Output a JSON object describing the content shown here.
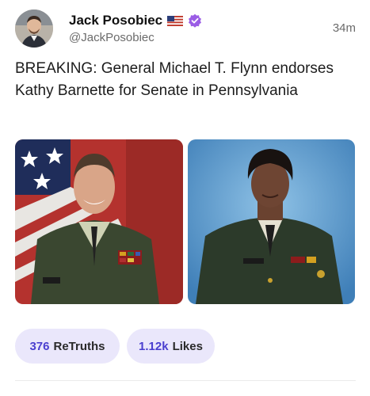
{
  "post": {
    "author_name": "Jack Posobiec",
    "author_handle": "@JackPosobiec",
    "timestamp": "34m",
    "text": "BREAKING: General Michael T. Flynn endorses Kathy Barnette for Senate in Pennsylvania",
    "flag_icon": "us-flag-icon",
    "verified_icon": "verified-badge-icon",
    "verified_color": "#9b5de5",
    "accent_color": "#4a3fcf",
    "pill_bg": "#eae7fb",
    "images": [
      {
        "icon": "photo-general-flynn"
      },
      {
        "icon": "photo-kathy-barnette"
      }
    ],
    "stats": {
      "retruths_count": "376",
      "retruths_label": "ReTruths",
      "likes_count": "1.12k",
      "likes_label": "Likes"
    }
  }
}
